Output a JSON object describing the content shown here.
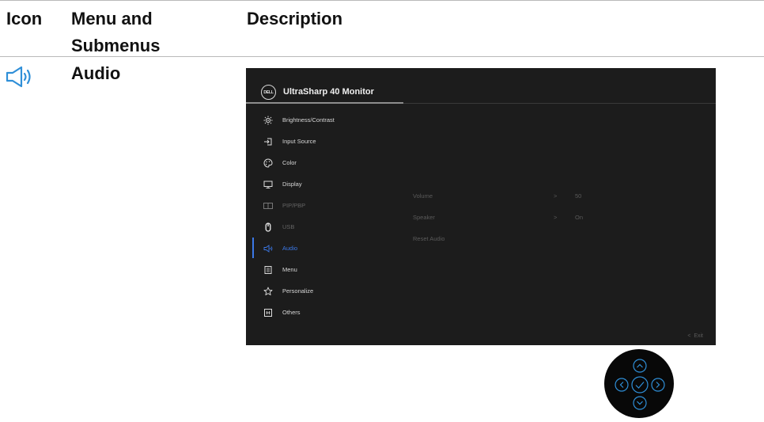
{
  "table": {
    "headers": {
      "icon": "Icon",
      "menu_line1": "Menu and",
      "menu_line2": "Submenus",
      "description": "Description"
    },
    "row": {
      "menu_name": "Audio",
      "icon": "speaker-icon"
    }
  },
  "osd": {
    "logo_text": "DELL",
    "title": "UltraSharp 40 Monitor",
    "menu_items": [
      {
        "label": "Brightness/Contrast",
        "icon": "brightness-icon"
      },
      {
        "label": "Input Source",
        "icon": "input-source-icon"
      },
      {
        "label": "Color",
        "icon": "color-palette-icon"
      },
      {
        "label": "Display",
        "icon": "display-icon"
      },
      {
        "label": "PIP/PBP",
        "icon": "pip-pbp-icon"
      },
      {
        "label": "USB",
        "icon": "usb-mouse-icon"
      },
      {
        "label": "Audio",
        "icon": "speaker-icon"
      },
      {
        "label": "Menu",
        "icon": "menu-icon"
      },
      {
        "label": "Personalize",
        "icon": "star-icon"
      },
      {
        "label": "Others",
        "icon": "others-icon"
      }
    ],
    "submenu": [
      {
        "label": "Volume",
        "chevron": ">",
        "value": "50"
      },
      {
        "label": "Speaker",
        "chevron": ">",
        "value": "On"
      },
      {
        "label": "Reset Audio"
      }
    ],
    "exit_label": "Exit",
    "exit_chevron": "<",
    "accent_color": "#3b78e7"
  },
  "joystick": {
    "buttons": [
      "up-arrow-icon",
      "left-arrow-icon",
      "check-icon",
      "right-arrow-icon",
      "down-arrow-icon"
    ],
    "ring_color": "#2f8fd8"
  }
}
